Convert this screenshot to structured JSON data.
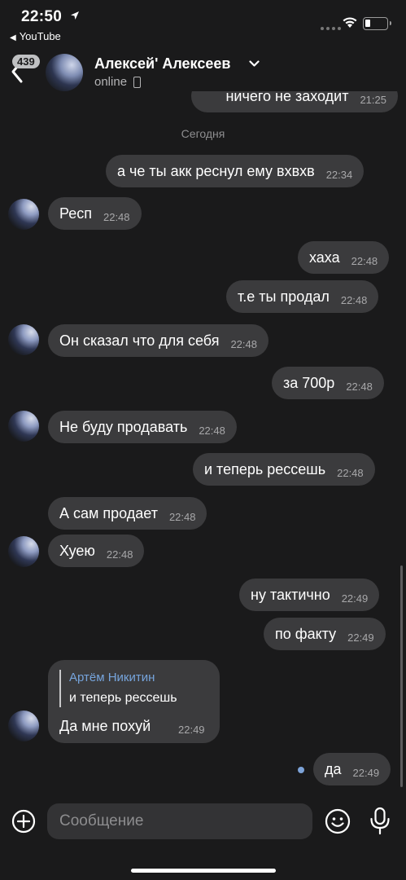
{
  "status_bar": {
    "time": "22:50",
    "back_app": "YouTube"
  },
  "header": {
    "unread_count": "439",
    "contact_name": "Алексей' Алексеев",
    "status": "online"
  },
  "chat": {
    "date_separator": "Сегодня",
    "messages": [
      {
        "side": "out",
        "text": "ничего не заходит",
        "time": "21:25"
      },
      {
        "side": "out",
        "text": "а че ты акк реснул ему вхвхв",
        "time": "22:34"
      },
      {
        "side": "in",
        "text": "Респ",
        "time": "22:48"
      },
      {
        "side": "out",
        "text": "хаха",
        "time": "22:48"
      },
      {
        "side": "out",
        "text": "т.е ты продал",
        "time": "22:48"
      },
      {
        "side": "in",
        "text": "Он сказал что для себя",
        "time": "22:48"
      },
      {
        "side": "out",
        "text": "за 700р",
        "time": "22:48"
      },
      {
        "side": "in",
        "text": "Не буду продавать",
        "time": "22:48"
      },
      {
        "side": "out",
        "text": "и теперь рессешь",
        "time": "22:48"
      },
      {
        "side": "in",
        "text": "А сам продает",
        "time": "22:48"
      },
      {
        "side": "in",
        "text": "Хуею",
        "time": "22:48"
      },
      {
        "side": "out",
        "text": "ну тактично",
        "time": "22:49"
      },
      {
        "side": "out",
        "text": "по факту",
        "time": "22:49"
      },
      {
        "side": "out",
        "text": "да",
        "time": "22:49"
      }
    ],
    "reply_message": {
      "quoted_author": "Артём Никитин",
      "quoted_text": "и теперь рессешь",
      "text": "Да мне похуй",
      "time": "22:49"
    }
  },
  "composer": {
    "placeholder": "Сообщение"
  },
  "colors": {
    "background": "#1a1a1b",
    "bubble": "#3b3b3d",
    "reply_author": "#76a4dc",
    "unread_dot": "#7da3d8"
  },
  "icons": [
    "location-arrow-icon",
    "wifi-icon",
    "battery-icon",
    "back-chevron-icon",
    "chevron-down-icon",
    "phone-icon",
    "plus-icon",
    "smile-icon",
    "microphone-icon"
  ]
}
